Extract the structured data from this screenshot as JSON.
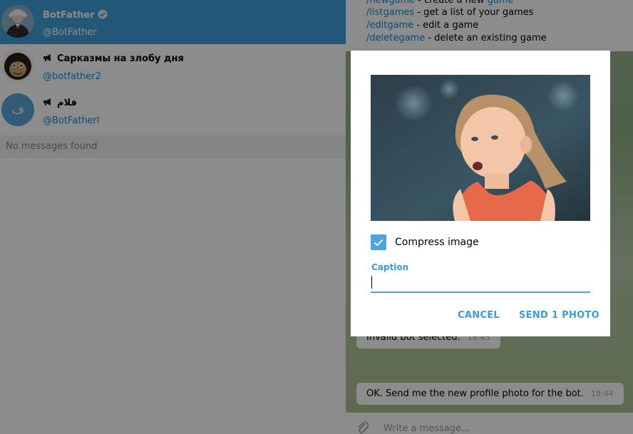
{
  "search_results": [
    {
      "name": "BotFather",
      "sub": "@BotFather",
      "verified": true,
      "channel": false,
      "active": true
    },
    {
      "name": "Сарказмы на злобу дня",
      "sub": "@botfather2",
      "verified": false,
      "channel": true,
      "active": false
    },
    {
      "name": "فلام",
      "sub": "@BotFatherl",
      "verified": false,
      "channel": true,
      "active": false,
      "avatar_letter": "ف"
    }
  ],
  "no_messages": "No messages found",
  "commands": [
    {
      "cmd": "/newgame",
      "desc": " - create a new ",
      "tail": "game"
    },
    {
      "cmd": "/listgames",
      "desc": " - get a list of your games",
      "tail": ""
    },
    {
      "cmd": "/editgame",
      "desc": " - edit a game",
      "tail": ""
    },
    {
      "cmd": "/deletegame",
      "desc": " - delete an existing game",
      "tail": ""
    }
  ],
  "messages": [
    {
      "text": "Invalid bot selected.",
      "time": "18:43"
    },
    {
      "text": "OK. Send me the new profile photo for the bot.",
      "time": "18:44"
    }
  ],
  "composer": {
    "placeholder": "Write a message..."
  },
  "dialog": {
    "compress_label": "Compress image",
    "compress_checked": true,
    "caption_label": "Caption",
    "caption_value": "",
    "cancel_label": "CANCEL",
    "send_label": "SEND 1 PHOTO"
  },
  "colors": {
    "accent": "#419fd9",
    "link": "#168acd",
    "dialog_accent": "#3a9bd6",
    "checkbox": "#4ea4e0"
  }
}
